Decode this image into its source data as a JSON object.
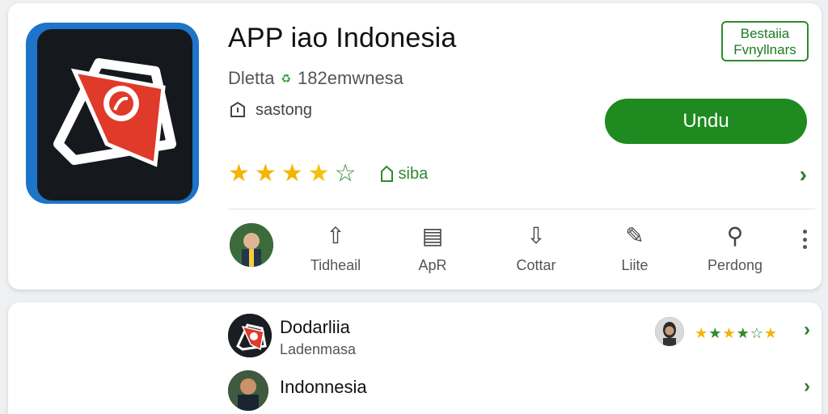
{
  "app": {
    "title": "APP iao Indonesia",
    "developer": "Dletta",
    "developer_suffix": "182emwnesa",
    "meta": "sastong",
    "badge_line1": "Bestaiia",
    "badge_line2": "Fvnyllnars",
    "install_label": "Undu",
    "rating": 3.5,
    "tag_label": "siba",
    "colors": {
      "accent": "#1f8a1f",
      "star": "#f4b400",
      "icon_bg": "#1d74c8"
    }
  },
  "actions": [
    {
      "label": "Tidheail",
      "icon": "share-up-icon"
    },
    {
      "label": "ApR",
      "icon": "document-icon"
    },
    {
      "label": "Cottar",
      "icon": "download-icon"
    },
    {
      "label": "Liite",
      "icon": "edit-icon"
    },
    {
      "label": "Perdong",
      "icon": "search-icon"
    }
  ],
  "list": [
    {
      "title": "Dodarliia",
      "subtitle": "Ladenmasa",
      "rating": 4.5
    },
    {
      "title": "Indonnesia"
    }
  ]
}
